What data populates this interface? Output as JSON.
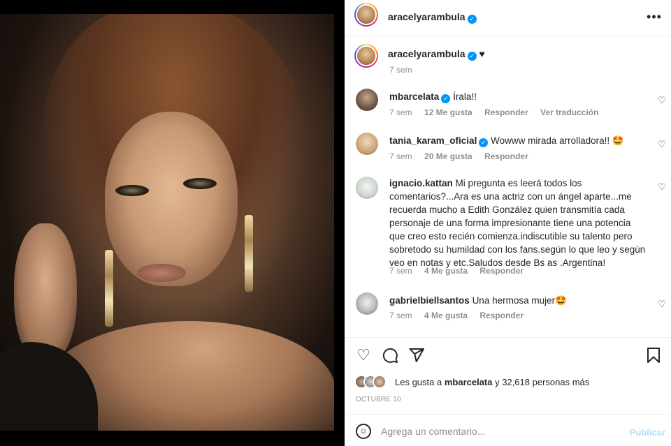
{
  "post": {
    "author": "aracelyarambula",
    "caption_suffix": "♥",
    "caption_age": "7 sem"
  },
  "comments": [
    {
      "user": "mbarcelata",
      "verified": true,
      "text": "Íralа!!",
      "age": "7 sem",
      "likes": "12 Me gusta",
      "reply": "Responder",
      "translate": "Ver traducción"
    },
    {
      "user": "tania_karam_oficial",
      "verified": true,
      "text": "Wowww mirada arrolladora!! 🤩",
      "age": "7 sem",
      "likes": "20 Me gusta",
      "reply": "Responder"
    },
    {
      "user": "ignacio.kattan",
      "verified": false,
      "text": "Mi pregunta es leerá todos los comentarios?...Ara es una actriz con un ángel aparte...me recuerda mucho a Edith González quien transmitía cada personaje de una forma impresionante tiene una potencia que creo esto recién comienza.indiscutible su talento pero sobretodo su humildad con los fans.según lo que leo y según veo en notas y etc.Saludos desde Bs as .Argentina!",
      "age": "7 sem",
      "likes": "4 Me gusta",
      "reply": "Responder"
    },
    {
      "user": "gabrielbiellsantos",
      "verified": false,
      "text": "Una hermosa mujer🤩",
      "age": "7 sem",
      "likes": "4 Me gusta",
      "reply": "Responder"
    }
  ],
  "likes": {
    "prefix": "Les gusta a",
    "user": "mbarcelata",
    "suffix": "y 32,618 personas más"
  },
  "date": "OCTUBRE 10",
  "add_comment": {
    "placeholder": "Agrega un comentario...",
    "post_label": "Publicar"
  },
  "icons": {
    "more": "more-horizontal-icon",
    "like": "heart-icon",
    "comment": "comment-bubble-icon",
    "share": "paper-plane-icon",
    "save": "bookmark-icon",
    "emoji": "smiley-icon"
  },
  "colors": {
    "verified": "#0095f6",
    "muted": "#8e8e8e",
    "post_disabled": "#b2dffc"
  }
}
